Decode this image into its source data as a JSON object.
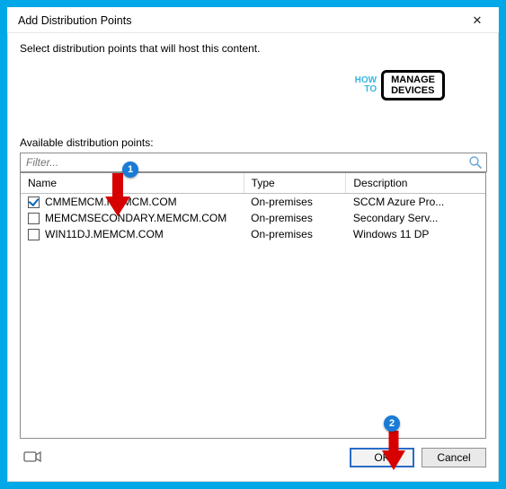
{
  "window": {
    "title": "Add Distribution Points",
    "close_glyph": "✕"
  },
  "instruction": "Select distribution points that will host this content.",
  "section": {
    "label": "Available distribution points:",
    "filter_placeholder": "Filter..."
  },
  "columns": {
    "name": "Name",
    "type": "Type",
    "desc": "Description"
  },
  "rows": [
    {
      "checked": true,
      "name": "CMMEMCM.MEMCM.COM",
      "type": "On-premises",
      "desc": "SCCM Azure Pro..."
    },
    {
      "checked": false,
      "name": "MEMCMSECONDARY.MEMCM.COM",
      "type": "On-premises",
      "desc": "Secondary Serv..."
    },
    {
      "checked": false,
      "name": "WIN11DJ.MEMCM.COM",
      "type": "On-premises",
      "desc": "Windows 11 DP"
    }
  ],
  "buttons": {
    "ok": "OK",
    "cancel": "Cancel"
  },
  "watermark": {
    "left_top": "HOW",
    "left_bottom": "TO",
    "right_top": "MANAGE",
    "right_bottom": "DEVICES"
  },
  "callouts": {
    "one": "1",
    "two": "2"
  }
}
